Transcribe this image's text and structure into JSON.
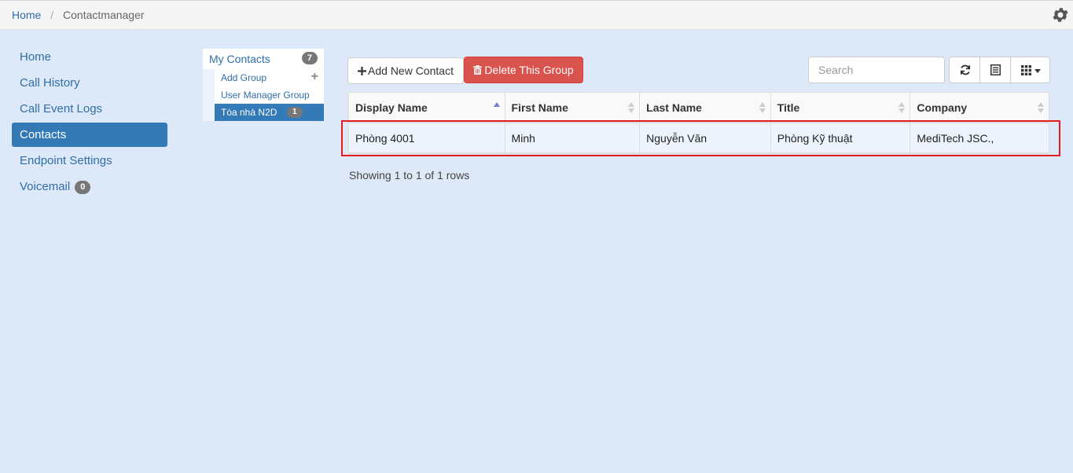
{
  "breadcrumb": {
    "home": "Home",
    "current": "Contactmanager"
  },
  "settings_icon": "gear-icon",
  "sidebar": {
    "items": [
      {
        "label": "Home"
      },
      {
        "label": "Call History"
      },
      {
        "label": "Call Event Logs"
      },
      {
        "label": "Contacts",
        "active": true
      },
      {
        "label": "Endpoint Settings"
      },
      {
        "label": "Voicemail",
        "badge": "0"
      }
    ]
  },
  "groups": {
    "my_contacts": "My Contacts",
    "my_contacts_count": "7",
    "add_group": "Add Group",
    "user_manager_group": "User Manager Group",
    "selected_group": "Tòa nhà N2D",
    "selected_group_count": "1"
  },
  "toolbar": {
    "add_label": "Add New Contact",
    "delete_label": "Delete This Group",
    "search_placeholder": "Search"
  },
  "table": {
    "columns": [
      "Display Name",
      "First Name",
      "Last Name",
      "Title",
      "Company"
    ],
    "rows": [
      [
        "Phòng 4001",
        "Minh",
        "Nguyễn Văn",
        "Phòng Kỹ thuật",
        "MediTech JSC.,"
      ]
    ],
    "footer": "Showing 1 to 1 of 1 rows"
  },
  "colors": {
    "primary": "#337ab7",
    "danger": "#d9534f",
    "highlight": "#e41c1c",
    "background": "#dde9f8"
  }
}
